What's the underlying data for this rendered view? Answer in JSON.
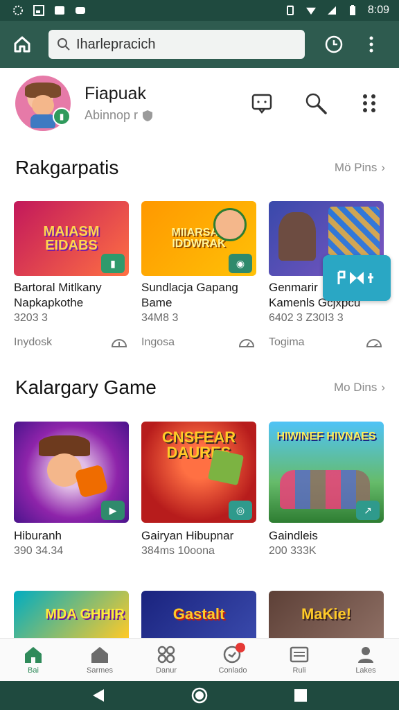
{
  "status_bar": {
    "time": "8:09"
  },
  "search": {
    "placeholder": "",
    "value": "Iharlepracich"
  },
  "profile": {
    "name": "Fiapuak",
    "subtitle": "Abinnop r"
  },
  "sections": [
    {
      "title": "Rakgarpatis",
      "more": "Mö Pins",
      "cards": [
        {
          "art": "MAIASM EIDABS",
          "name_line1": "Bartoral Mitlkany",
          "name_line2": "Napkapkothe",
          "meta": "3203 3",
          "foot": "Inydosk",
          "colors": [
            "#c2185b",
            "#ff7043"
          ]
        },
        {
          "art": "MIIARSAK IDDWRAK",
          "name_line1": "Sundlacja Gapang",
          "name_line2": "Bame",
          "meta": "34M8 3",
          "foot": "Ingosa",
          "colors": [
            "#ff9800",
            "#ffc107"
          ]
        },
        {
          "art": "",
          "name_line1": "Genmarir",
          "name_line2": "Kamenls Gcjxpcu",
          "meta": "6402 3 Z30I3 3",
          "foot": "Togima",
          "colors": [
            "#3949ab",
            "#7e57c2"
          ]
        }
      ]
    },
    {
      "title": "Kalargary Game",
      "more": "Mo Dins",
      "cards": [
        {
          "art": "",
          "name_line1": "Hiburanh",
          "name_line2": "",
          "meta": "390 34.34",
          "foot": "",
          "colors": [
            "#8e24aa",
            "#ab47bc"
          ]
        },
        {
          "art": "CNSFEAR DAURES",
          "name_line1": "Gairyan Hibupnar",
          "name_line2": "",
          "meta": "384ms 10oona",
          "foot": "",
          "colors": [
            "#b71c1c",
            "#e53935"
          ]
        },
        {
          "art": "HIWINEF HIVNAES",
          "name_line1": "Gaindleis",
          "name_line2": "",
          "meta": "200 333K",
          "foot": "",
          "colors": [
            "#2e7d32",
            "#81c784"
          ]
        }
      ]
    },
    {
      "cards": [
        {
          "art": "MDA GHHIR",
          "colors": [
            "#00acc1",
            "#ffca28"
          ]
        },
        {
          "art": "Gastalt",
          "colors": [
            "#1a237e",
            "#3949ab"
          ]
        },
        {
          "art": "MaKie!",
          "colors": [
            "#5d4037",
            "#8d6e63"
          ]
        }
      ]
    }
  ],
  "bottom_nav": [
    {
      "label": "Bai",
      "icon": "home-icon",
      "active": true
    },
    {
      "label": "Sarmes",
      "icon": "store-icon"
    },
    {
      "label": "Danur",
      "icon": "grid-icon"
    },
    {
      "label": "Conlado",
      "icon": "chat-icon",
      "badge": ""
    },
    {
      "label": "Ruli",
      "icon": "list-icon"
    },
    {
      "label": "Lakes",
      "icon": "person-icon"
    }
  ],
  "colors": {
    "appbar": "#2e5b4f",
    "status": "#1f4a3f",
    "accent": "#2f8a5a"
  }
}
